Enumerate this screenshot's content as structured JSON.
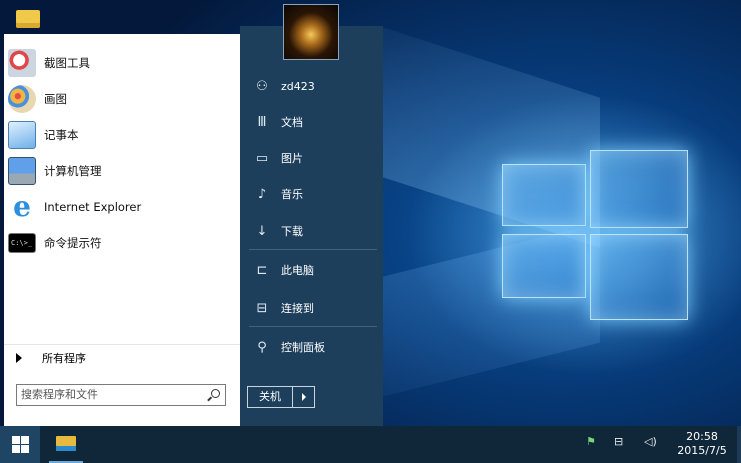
{
  "apps": [
    {
      "label": "截图工具",
      "icon": "snipping-tool-icon",
      "color": "#e04848"
    },
    {
      "label": "画图",
      "icon": "paint-icon",
      "color": "#f0b640"
    },
    {
      "label": "记事本",
      "icon": "notepad-icon",
      "color": "#6fb0e8"
    },
    {
      "label": "计算机管理",
      "icon": "computer-management-icon",
      "color": "#3a78c8"
    },
    {
      "label": "Internet Explorer",
      "icon": "internet-explorer-icon",
      "color": "#2a8fe0"
    },
    {
      "label": "命令提示符",
      "icon": "command-prompt-icon",
      "color": "#000000"
    }
  ],
  "all_programs": "所有程序",
  "search": {
    "placeholder": "搜索程序和文件"
  },
  "places": [
    {
      "label": "zd423",
      "icon": "user-icon"
    },
    {
      "label": "文档",
      "icon": "documents-icon"
    },
    {
      "label": "图片",
      "icon": "pictures-icon"
    },
    {
      "label": "音乐",
      "icon": "music-icon"
    },
    {
      "label": "下载",
      "icon": "downloads-icon"
    },
    {
      "label": "此电脑",
      "icon": "this-pc-icon"
    },
    {
      "label": "连接到",
      "icon": "connect-to-icon"
    },
    {
      "label": "控制面板",
      "icon": "control-panel-icon"
    }
  ],
  "shutdown": {
    "label": "关机"
  },
  "clock": {
    "time": "20:58",
    "date": "2015/7/5"
  },
  "colors": {
    "start_panel": "#1d3f5c",
    "taskbar": "#10273a",
    "accent": "#0c5aa8"
  }
}
